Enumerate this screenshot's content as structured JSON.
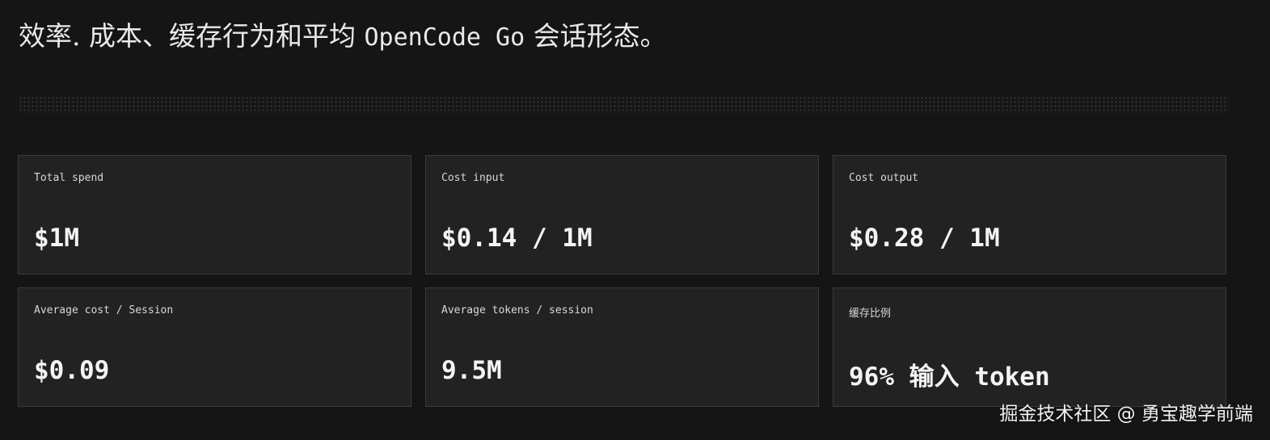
{
  "heading": {
    "prefix": "效率. 成本、缓存行为和平均 ",
    "product": "OpenCode Go",
    "suffix": " 会话形态。"
  },
  "metrics": [
    {
      "label": "Total spend",
      "value": "$1M"
    },
    {
      "label": "Cost input",
      "value": "$0.14 / 1M"
    },
    {
      "label": "Cost output",
      "value": "$0.28 / 1M"
    },
    {
      "label": "Average cost / Session",
      "value": "$0.09"
    },
    {
      "label": "Average tokens / session",
      "value": "9.5M"
    },
    {
      "label": "缓存比例",
      "value": "96% 输入 token"
    }
  ],
  "watermark": "掘金技术社区 @ 勇宝趣学前端",
  "colors": {
    "background": "#151515",
    "card": "#222222",
    "card_border": "#3a3a3a",
    "text": "#f4f4f4"
  }
}
